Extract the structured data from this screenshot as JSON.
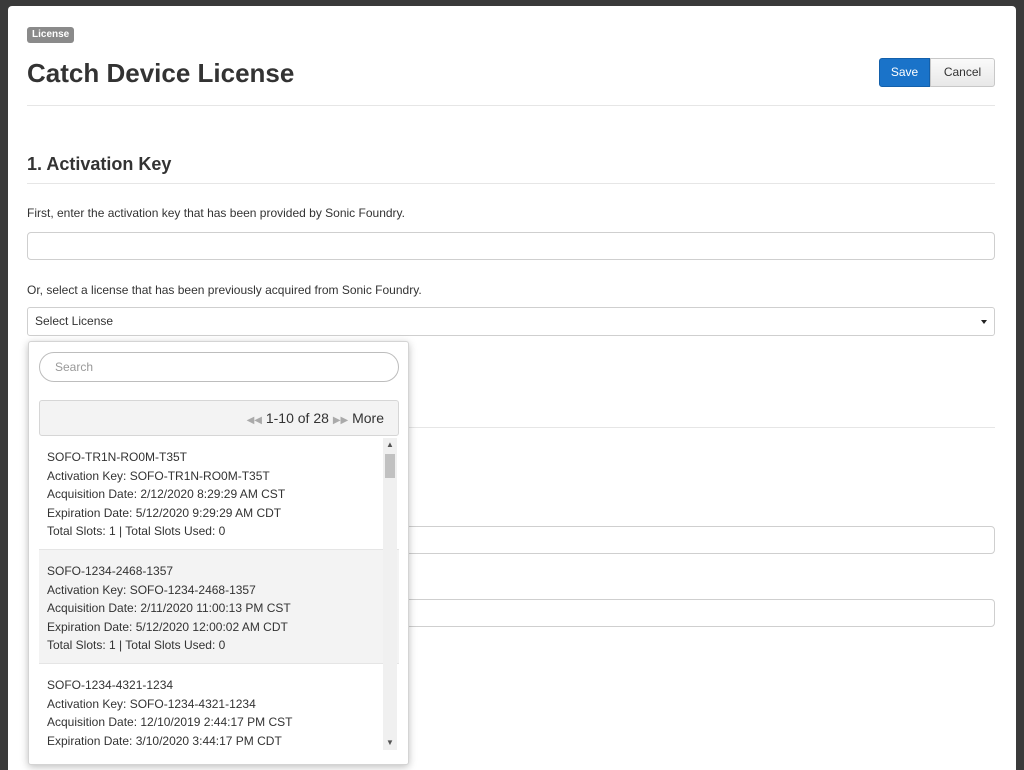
{
  "header": {
    "badge": "License",
    "title": "Catch Device License",
    "save_label": "Save",
    "cancel_label": "Cancel"
  },
  "section": {
    "title": "1. Activation Key",
    "help_key": "First, enter the activation key that has been provided by Sonic Foundry.",
    "activation_key_value": "",
    "help_select": "Or, select a license that has been previously acquired from Sonic Foundry.",
    "select_value": "Select License"
  },
  "dropdown": {
    "search_placeholder": "Search",
    "pager_label": "1-10 of 28",
    "more_label": "More",
    "items": [
      {
        "name": "SOFO-TR1N-RO0M-T35T",
        "activation_key": "Activation Key: SOFO-TR1N-RO0M-T35T",
        "acquisition": "Acquisition Date: 2/12/2020 8:29:29 AM CST",
        "expiration": "Expiration Date: 5/12/2020 9:29:29 AM CDT",
        "slots": "Total Slots: 1 | Total Slots Used: 0"
      },
      {
        "name": "SOFO-1234-2468-1357",
        "activation_key": "Activation Key: SOFO-1234-2468-1357",
        "acquisition": "Acquisition Date: 2/11/2020 11:00:13 PM CST",
        "expiration": "Expiration Date: 5/12/2020 12:00:02 AM CDT",
        "slots": "Total Slots: 1 | Total Slots Used: 0"
      },
      {
        "name": "SOFO-1234-4321-1234",
        "activation_key": "Activation Key: SOFO-1234-4321-1234",
        "acquisition": "Acquisition Date: 12/10/2019 2:44:17 PM CST",
        "expiration": "Expiration Date: 3/10/2020 3:44:17 PM CDT",
        "slots": ""
      }
    ]
  }
}
